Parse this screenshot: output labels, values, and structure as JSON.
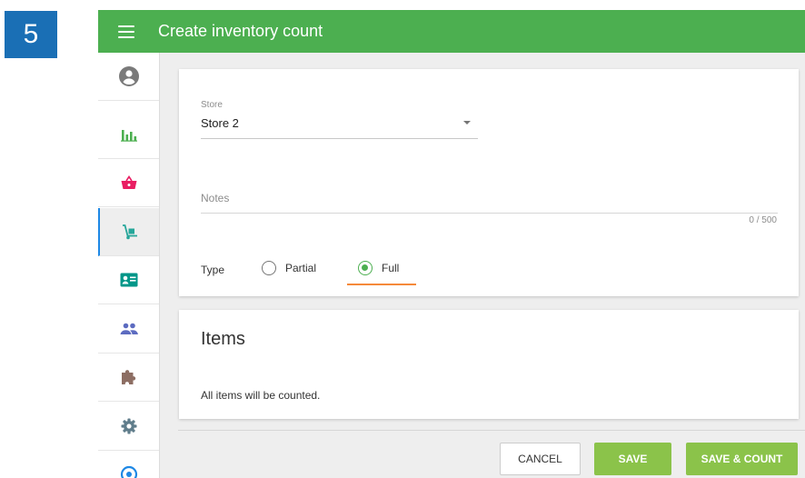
{
  "step_number": "5",
  "header": {
    "title": "Create inventory count"
  },
  "sidebar": {
    "items": [
      {
        "name": "account",
        "icon": "account-circle-icon"
      },
      {
        "name": "reports",
        "icon": "bar-chart-icon"
      },
      {
        "name": "items",
        "icon": "basket-icon"
      },
      {
        "name": "inventory",
        "icon": "hand-truck-icon",
        "active": true
      },
      {
        "name": "employees",
        "icon": "id-card-icon"
      },
      {
        "name": "customers",
        "icon": "people-icon"
      },
      {
        "name": "integrations",
        "icon": "puzzle-icon"
      },
      {
        "name": "settings",
        "icon": "gear-icon"
      },
      {
        "name": "help",
        "icon": "help-icon"
      }
    ]
  },
  "form": {
    "store_label": "Store",
    "store_value": "Store 2",
    "notes_placeholder": "Notes",
    "notes_counter": "0 / 500",
    "type_label": "Type",
    "type_options": [
      "Partial",
      "Full"
    ],
    "type_selected": "Full"
  },
  "items_section": {
    "heading": "Items",
    "description": "All items will be counted."
  },
  "actions": {
    "cancel": "CANCEL",
    "save": "SAVE",
    "save_count": "SAVE & COUNT"
  },
  "colors": {
    "header_green": "#4caf50",
    "button_green": "#8bc34a",
    "step_badge_blue": "#1a6fb5",
    "accent_orange": "#f5893a",
    "active_nav_blue": "#1e88e5"
  }
}
